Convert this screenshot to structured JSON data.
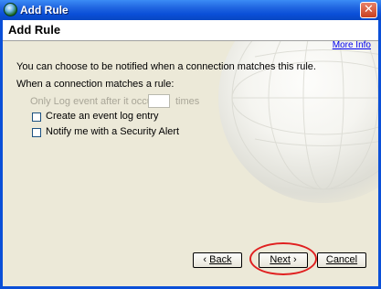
{
  "window": {
    "title": "Add Rule",
    "close_glyph": "✕"
  },
  "header": {
    "title": "Add Rule",
    "more_info": "More Info"
  },
  "content": {
    "intro": "You can choose to be notified when a connection matches this rule.",
    "when_label": "When a connection matches a rule:",
    "only_log_label": "Only Log event after it occurs",
    "count_value": "",
    "times_label": "times",
    "options": [
      {
        "label": "Create an event log entry",
        "checked": false
      },
      {
        "label": "Notify me with a Security Alert",
        "checked": false
      }
    ]
  },
  "buttons": {
    "back_arrow": "‹",
    "back_label": "Back",
    "next_label": "Next",
    "next_arrow": "›",
    "cancel_label": "Cancel"
  },
  "colors": {
    "title_bar": "#0a4fd8",
    "dialog_bg": "#ece9d8",
    "highlight_circle": "#e02020",
    "link": "#0000ee"
  },
  "icons": [
    "globe-app-icon",
    "close-icon",
    "globe-graphic"
  ]
}
